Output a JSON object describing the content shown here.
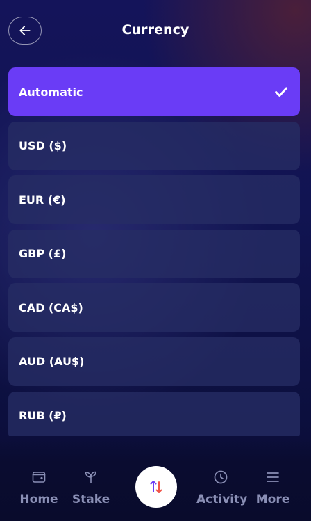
{
  "header": {
    "title": "Currency",
    "back_icon": "arrow-left-icon"
  },
  "currencies": [
    {
      "label": "Automatic",
      "selected": true
    },
    {
      "label": "USD ($)",
      "selected": false
    },
    {
      "label": "EUR (€)",
      "selected": false
    },
    {
      "label": "GBP (£)",
      "selected": false
    },
    {
      "label": "CAD (CA$)",
      "selected": false
    },
    {
      "label": "AUD (AU$)",
      "selected": false
    },
    {
      "label": "RUB (₽)",
      "selected": false
    }
  ],
  "nav": {
    "home": {
      "label": "Home",
      "icon": "wallet-icon"
    },
    "stake": {
      "label": "Stake",
      "icon": "sprout-icon"
    },
    "swap": {
      "icon": "swap-arrows-icon"
    },
    "activity": {
      "label": "Activity",
      "icon": "clock-icon"
    },
    "more": {
      "label": "More",
      "icon": "menu-icon"
    }
  },
  "colors": {
    "accent": "#6a3cf6",
    "item_bg": "#262d64",
    "nav_label": "#8a8fb5",
    "swap_up": "#6a3cf6",
    "swap_down": "#f0554a"
  }
}
